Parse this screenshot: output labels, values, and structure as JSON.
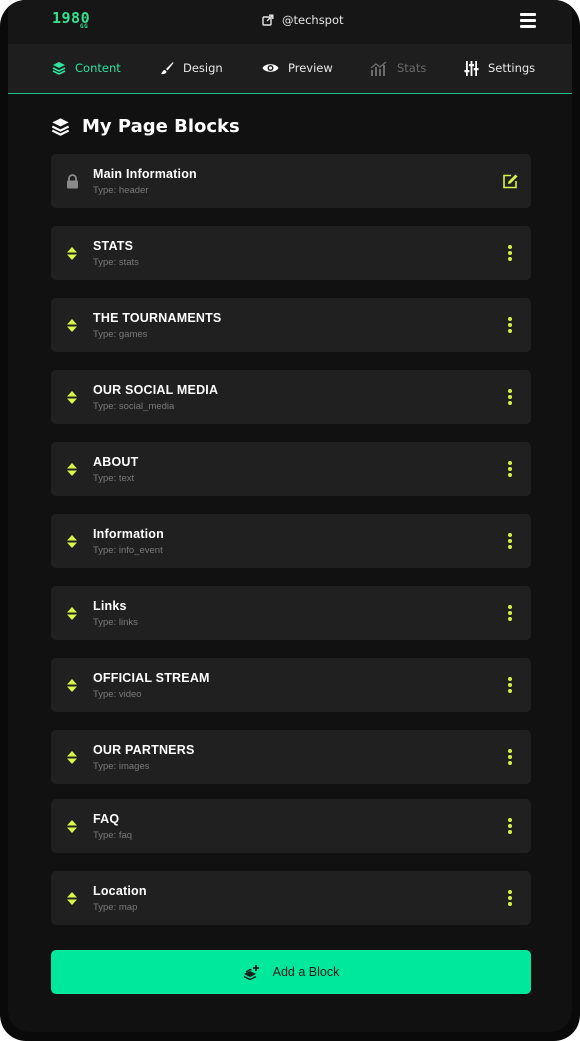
{
  "header": {
    "logo_text": "1980",
    "logo_sub": "GG",
    "handle": "@techspot",
    "icons": {
      "handle": "external-link-icon",
      "menu": "hamburger-menu-icon"
    }
  },
  "tabs": [
    {
      "label": "Content",
      "icon": "layers-icon",
      "state": "active"
    },
    {
      "label": "Design",
      "icon": "brush-icon",
      "state": "normal"
    },
    {
      "label": "Preview",
      "icon": "eye-icon",
      "state": "normal"
    },
    {
      "label": "Stats",
      "icon": "stats-chart-icon",
      "state": "disabled"
    },
    {
      "label": "Settings",
      "icon": "sliders-icon",
      "state": "normal"
    }
  ],
  "section": {
    "title": "My Page Blocks",
    "icon": "layers-icon"
  },
  "blocks": [
    {
      "name": "Main Information",
      "type": "Type: header",
      "locked": true
    },
    {
      "name": "STATS",
      "type": "Type: stats"
    },
    {
      "name": "THE TOURNAMENTS",
      "type": "Type: games"
    },
    {
      "name": "OUR SOCIAL MEDIA",
      "type": "Type: social_media"
    },
    {
      "name": "ABOUT",
      "type": "Type: text"
    },
    {
      "name": "Information",
      "type": "Type: info_event"
    },
    {
      "name": "Links",
      "type": "Type: links"
    },
    {
      "name": "OFFICIAL STREAM",
      "type": "Type: video"
    },
    {
      "name": "OUR PARTNERS",
      "type": "Type: images"
    },
    {
      "name": "FAQ",
      "type": "Type: faq"
    },
    {
      "name": "Location",
      "type": "Type: map"
    }
  ],
  "add_button": {
    "label": "Add a Block",
    "icon": "add-block-icon"
  },
  "colors": {
    "accent": "#2ee59d",
    "button": "#00e89c",
    "handle_icon": "#d9f24a",
    "card": "#202020",
    "background": "#111111"
  }
}
